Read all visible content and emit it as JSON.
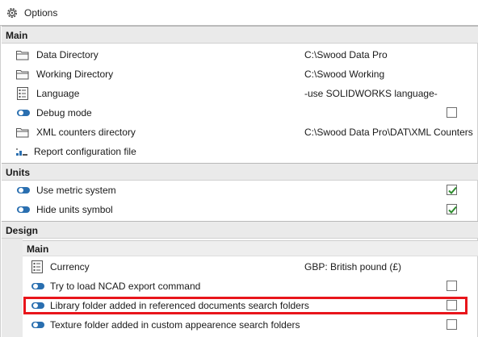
{
  "window": {
    "title": "Options"
  },
  "sections": {
    "main": {
      "title": "Main",
      "rows": [
        {
          "label": "Data Directory",
          "value": "C:\\Swood Data Pro",
          "icon": "folder-icon"
        },
        {
          "label": "Working Directory",
          "value": "C:\\Swood Working",
          "icon": "folder-icon"
        },
        {
          "label": "Language",
          "value": "-use SOLIDWORKS language-",
          "icon": "list-icon"
        },
        {
          "label": "Debug mode",
          "checked": false,
          "icon": "toggle-icon"
        },
        {
          "label": "XML counters directory",
          "value": "C:\\Swood Data Pro\\DAT\\XML Counters",
          "icon": "folder-icon"
        },
        {
          "label": "Report configuration file",
          "icon": "report-icon"
        }
      ]
    },
    "units": {
      "title": "Units",
      "rows": [
        {
          "label": "Use metric system",
          "checked": true,
          "icon": "toggle-icon"
        },
        {
          "label": "Hide units symbol",
          "checked": true,
          "icon": "toggle-icon"
        }
      ]
    },
    "design": {
      "title": "Design",
      "sub_title": "Main",
      "rows": [
        {
          "label": "Currency",
          "value": "GBP: British pound (£)",
          "icon": "list-icon"
        },
        {
          "label": "Try to load NCAD export command",
          "checked": false,
          "icon": "toggle-icon"
        },
        {
          "label": "Library folder added in referenced documents search folders",
          "checked": false,
          "icon": "toggle-icon",
          "highlighted": true
        },
        {
          "label": "Texture folder added in custom appearence search folders",
          "checked": false,
          "icon": "toggle-icon"
        }
      ]
    }
  },
  "colors": {
    "highlight": "#e8151b",
    "check": "#2e8b2e",
    "toggle": "#2a6fb0"
  }
}
